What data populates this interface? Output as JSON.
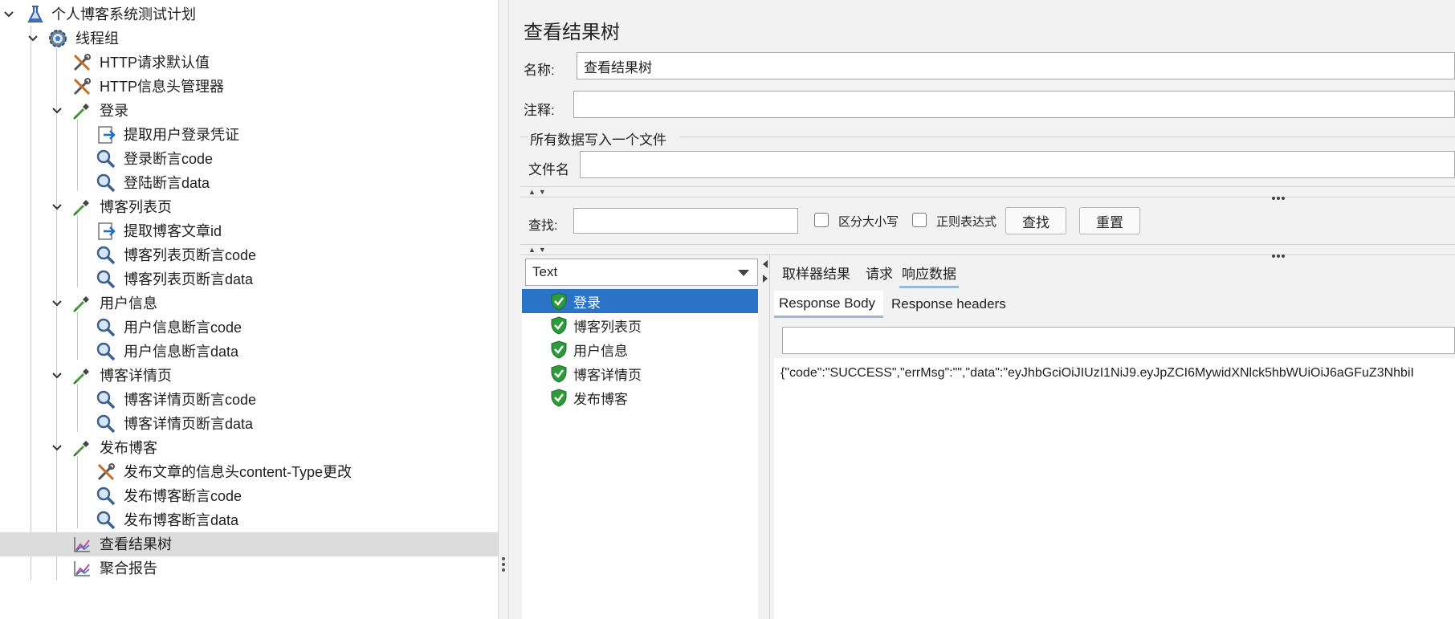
{
  "tree": {
    "items": [
      {
        "label": "个人博客系统测试计划",
        "icon": "beaker-icon",
        "expanded": true
      },
      {
        "label": "线程组",
        "icon": "gear-icon",
        "expanded": true
      },
      {
        "label": "HTTP请求默认值",
        "icon": "wrench-icon"
      },
      {
        "label": "HTTP信息头管理器",
        "icon": "wrench-icon"
      },
      {
        "label": "登录",
        "icon": "pipette-icon",
        "expanded": true
      },
      {
        "label": "提取用户登录凭证",
        "icon": "extractor-icon"
      },
      {
        "label": "登录断言code",
        "icon": "magnifier-icon"
      },
      {
        "label": "登陆断言data",
        "icon": "magnifier-icon"
      },
      {
        "label": "博客列表页",
        "icon": "pipette-icon",
        "expanded": true
      },
      {
        "label": "提取博客文章id",
        "icon": "extractor-icon"
      },
      {
        "label": "博客列表页断言code",
        "icon": "magnifier-icon"
      },
      {
        "label": "博客列表页断言data",
        "icon": "magnifier-icon"
      },
      {
        "label": "用户信息",
        "icon": "pipette-icon",
        "expanded": true
      },
      {
        "label": "用户信息断言code",
        "icon": "magnifier-icon"
      },
      {
        "label": "用户信息断言data",
        "icon": "magnifier-icon"
      },
      {
        "label": "博客详情页",
        "icon": "pipette-icon",
        "expanded": true
      },
      {
        "label": "博客详情页断言code",
        "icon": "magnifier-icon"
      },
      {
        "label": "博客详情页断言data",
        "icon": "magnifier-icon"
      },
      {
        "label": "发布博客",
        "icon": "pipette-icon",
        "expanded": true
      },
      {
        "label": "发布文章的信息头content-Type更改",
        "icon": "wrench-icon"
      },
      {
        "label": "发布博客断言code",
        "icon": "magnifier-icon"
      },
      {
        "label": "发布博客断言data",
        "icon": "magnifier-icon"
      },
      {
        "label": "查看结果树",
        "icon": "graph-icon",
        "selected": true
      },
      {
        "label": "聚合报告",
        "icon": "graph-icon"
      }
    ]
  },
  "panel": {
    "title": "查看结果树",
    "name_label": "名称:",
    "name_value": "查看结果树",
    "comment_label": "注释:",
    "comment_value": "",
    "file_group_label": "所有数据写入一个文件",
    "filename_label": "文件名",
    "filename_value": ""
  },
  "search": {
    "label": "查找:",
    "value": "",
    "case_label": "区分大小写",
    "regex_label": "正则表达式",
    "find_button": "查找",
    "reset_button": "重置"
  },
  "renderer": {
    "selected": "Text"
  },
  "results": {
    "items": [
      {
        "label": "登录",
        "status": "success",
        "selected": true
      },
      {
        "label": "博客列表页",
        "status": "success"
      },
      {
        "label": "用户信息",
        "status": "success"
      },
      {
        "label": "博客详情页",
        "status": "success"
      },
      {
        "label": "发布博客",
        "status": "success"
      }
    ]
  },
  "detail": {
    "tabs": [
      "取样器结果",
      "请求",
      "响应数据"
    ],
    "active_tab": "响应数据",
    "subtabs": [
      "Response Body",
      "Response headers"
    ],
    "active_subtab": "Response Body",
    "body_search_value": "",
    "response_text": "{\"code\":\"SUCCESS\",\"errMsg\":\"\",\"data\":\"eyJhbGciOiJIUzI1NiJ9.eyJpZCI6MywidXNlck5hbWUiOiJ6aGFuZ3NhbiI"
  },
  "colors": {
    "selection": "#2b73c6",
    "success": "#2e9b3a",
    "tree_selected": "#dcdcdc"
  }
}
